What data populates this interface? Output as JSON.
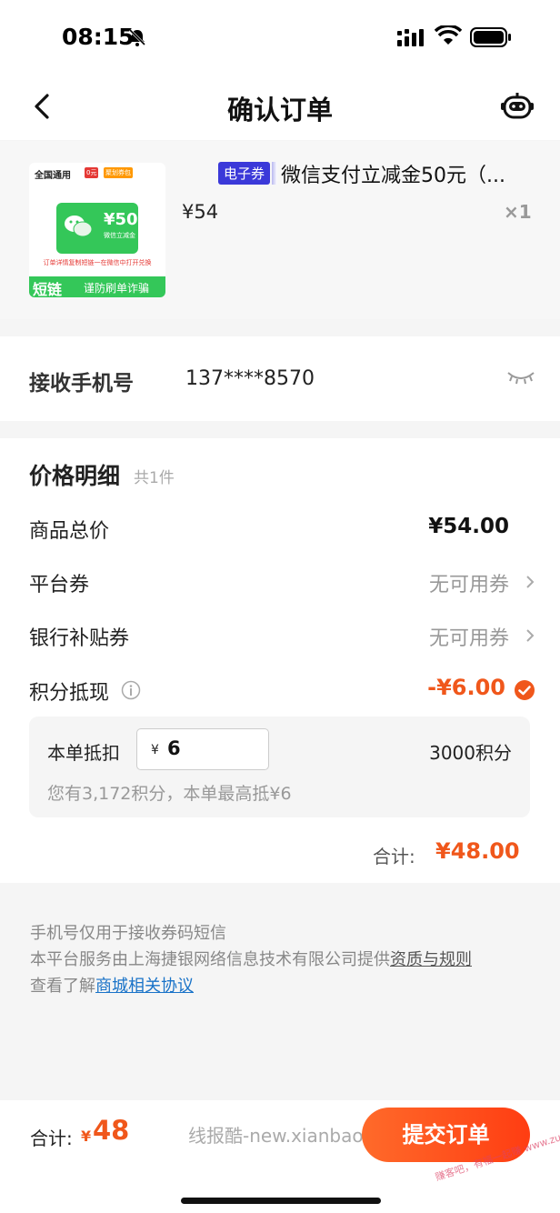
{
  "status_bar": {
    "time": "08:15"
  },
  "nav": {
    "title": "确认订单"
  },
  "product": {
    "thumbnail": {
      "title": "全国通用",
      "badge1": "0元",
      "badge2": "聚划券包",
      "amount": "¥50",
      "label": "微信立减金",
      "tip": "订单详情复制短链一在微信中打开兑换",
      "short_link": "短链",
      "warning": "谨防刷单诈骗"
    },
    "tag": "电子券",
    "name": "微信支付立减金50元（...",
    "price": "¥54",
    "quantity": "×1"
  },
  "phone": {
    "label": "接收手机号",
    "value": "137****8570"
  },
  "price_detail": {
    "title": "价格明细",
    "count": "共1件",
    "rows": [
      {
        "label": "商品总价",
        "value": "¥54.00"
      },
      {
        "label": "平台券",
        "value": "无可用券"
      },
      {
        "label": "银行补贴券",
        "value": "无可用券"
      },
      {
        "label": "积分抵现",
        "value": "-¥6.00"
      }
    ],
    "deduct": {
      "label": "本单抵扣",
      "yen": "¥",
      "input_value": "6",
      "points": "3000积分",
      "hint": "您有3,172积分，本单最高抵¥6"
    },
    "sum_label": "合计:",
    "sum_value": "¥48.00"
  },
  "notes": {
    "line1": "手机号仅用于接收券码短信",
    "line2": "本平台服务由上海捷银网络信息技术有限公司提供",
    "line2_link": "资质与规则",
    "line3": "查看了解",
    "line3_link": "商城相关协议"
  },
  "bottom_bar": {
    "label": "合计:",
    "yen": "¥",
    "amount": "48",
    "watermark": "线报酷-new.xianbao.fun",
    "submit_label": "提交订单",
    "stamp": "赚客吧，有福一起赚 www.zuanke8.com"
  },
  "colors": {
    "accent": "#f0571b",
    "tag": "#3b39d9",
    "green": "#34c759",
    "link": "#1a73c8"
  }
}
